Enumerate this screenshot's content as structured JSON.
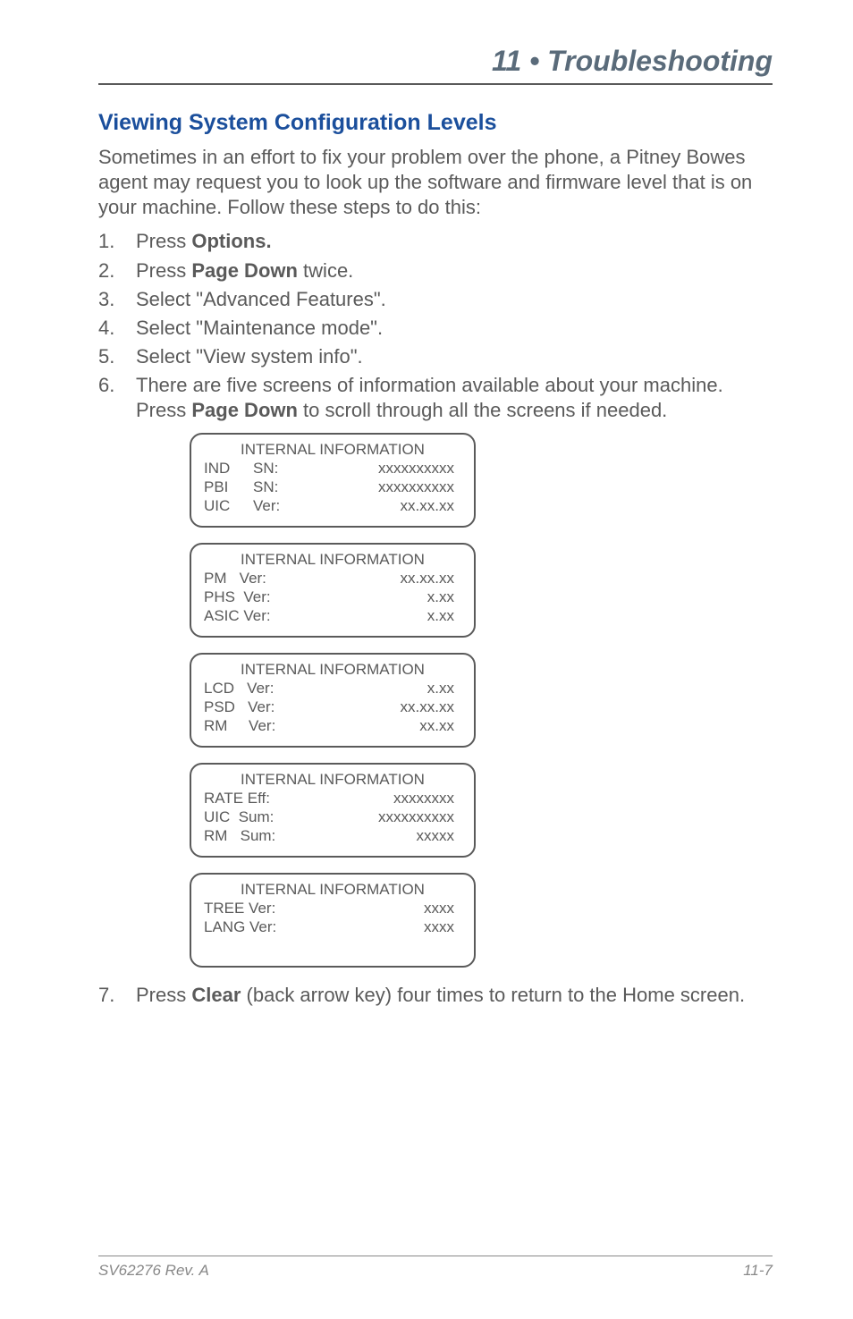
{
  "header": {
    "chapter": "11 • Troubleshooting"
  },
  "section": {
    "heading": "Viewing System Configuration Levels",
    "intro": "Sometimes in an effort to fix your problem over the phone, a Pitney Bowes agent may request you to look up the software and firmware level that is on your machine. Follow these steps to do this:"
  },
  "steps": {
    "s1a": "Press ",
    "s1b": "Options.",
    "s2a": "Press ",
    "s2b": "Page Down",
    "s2c": " twice.",
    "s3": "Select \"Advanced Features\".",
    "s4": "Select \"Maintenance mode\".",
    "s5": "Select \"View system info\".",
    "s6a": "There are five screens of information available about your machine. Press ",
    "s6b": "Page Down",
    "s6c": " to scroll through all the screens if needed.",
    "s7a": "Press ",
    "s7b": "Clear",
    "s7c": " (back arrow key) four times to return to the Home screen."
  },
  "boxes": {
    "title": "INTERNAL INFORMATION",
    "b1": {
      "r1": {
        "c1": "IND",
        "c2": "SN:",
        "c3": "xxxxxxxxxx"
      },
      "r2": {
        "c1": "PBI",
        "c2": "SN:",
        "c3": "xxxxxxxxxx"
      },
      "r3": {
        "c1": "UIC",
        "c2": "Ver:",
        "c3": "xx.xx.xx"
      }
    },
    "b2": {
      "r1": {
        "l": "PM   Ver:",
        "r": "xx.xx.xx"
      },
      "r2": {
        "l": "PHS  Ver:",
        "r": "x.xx"
      },
      "r3": {
        "l": "ASIC Ver:",
        "r": "x.xx"
      }
    },
    "b3": {
      "r1": {
        "l": "LCD   Ver:",
        "r": "x.xx"
      },
      "r2": {
        "l": "PSD   Ver:",
        "r": "xx.xx.xx"
      },
      "r3": {
        "l": "RM     Ver:",
        "r": "xx.xx"
      }
    },
    "b4": {
      "r1": {
        "l": "RATE Eff:",
        "r": "xxxxxxxx"
      },
      "r2": {
        "l": "UIC  Sum:",
        "r": "xxxxxxxxxx"
      },
      "r3": {
        "l": "RM   Sum:",
        "r": "xxxxx"
      }
    },
    "b5": {
      "r1": {
        "l": "TREE Ver:",
        "r": "xxxx"
      },
      "r2": {
        "l": "LANG Ver:",
        "r": "xxxx"
      }
    }
  },
  "footer": {
    "left": "SV62276 Rev. A",
    "right": "11-7"
  }
}
